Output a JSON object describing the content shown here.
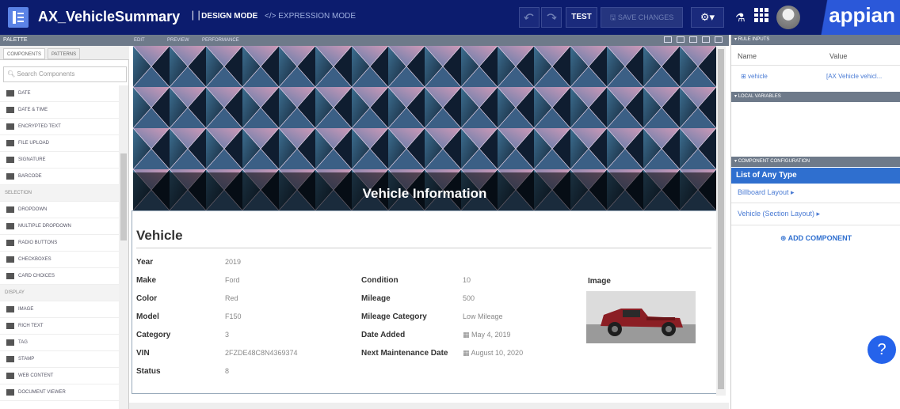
{
  "header": {
    "app_title": "AX_VehicleSummary",
    "design_mode": "DESIGN MODE",
    "expression_mode": "EXPRESSION MODE",
    "test": "TEST",
    "save": "SAVE CHANGES",
    "brand": "appian"
  },
  "palette": {
    "title": "PALETTE",
    "tabs": [
      "COMPONENTS",
      "PATTERNS"
    ],
    "search_placeholder": "Search Components",
    "items": [
      {
        "label": "DATE",
        "section": false
      },
      {
        "label": "DATE & TIME",
        "section": false
      },
      {
        "label": "ENCRYPTED TEXT",
        "section": false
      },
      {
        "label": "FILE UPLOAD",
        "section": false
      },
      {
        "label": "SIGNATURE",
        "section": false
      },
      {
        "label": "BARCODE",
        "section": false
      },
      {
        "label": "SELECTION",
        "section": true
      },
      {
        "label": "DROPDOWN",
        "section": false
      },
      {
        "label": "MULTIPLE DROPDOWN",
        "section": false
      },
      {
        "label": "RADIO BUTTONS",
        "section": false
      },
      {
        "label": "CHECKBOXES",
        "section": false
      },
      {
        "label": "CARD CHOICES",
        "section": false
      },
      {
        "label": "DISPLAY",
        "section": true
      },
      {
        "label": "IMAGE",
        "section": false
      },
      {
        "label": "RICH TEXT",
        "section": false
      },
      {
        "label": "TAG",
        "section": false
      },
      {
        "label": "STAMP",
        "section": false
      },
      {
        "label": "WEB CONTENT",
        "section": false
      },
      {
        "label": "DOCUMENT VIEWER",
        "section": false
      }
    ]
  },
  "canvas": {
    "tabs": [
      "EDIT",
      "PREVIEW",
      "PERFORMANCE"
    ],
    "banner_title": "Vehicle Information",
    "section_title": "Vehicle",
    "col1": [
      {
        "label": "Year",
        "value": "2019"
      },
      {
        "label": "Make",
        "value": "Ford"
      },
      {
        "label": "Color",
        "value": "Red"
      },
      {
        "label": "Model",
        "value": "F150"
      },
      {
        "label": "Category",
        "value": "3"
      },
      {
        "label": "VIN",
        "value": "2FZDE48C8N4369374"
      },
      {
        "label": "Status",
        "value": "8"
      }
    ],
    "col2": [
      {
        "label": "Condition",
        "value": "10"
      },
      {
        "label": "Mileage",
        "value": "500"
      },
      {
        "label": "Mileage Category",
        "value": "Low Mileage"
      },
      {
        "label": "Date Added",
        "value": "May 4, 2019"
      },
      {
        "label": "Next Maintenance Date",
        "value": "August 10, 2020"
      }
    ],
    "image_label": "Image"
  },
  "rules": {
    "rule_inputs": "RULE INPUTS",
    "name_header": "Name",
    "value_header": "Value",
    "param_name": "vehicle",
    "param_value": "[AX Vehicle vehicl...",
    "local_vars": "LOCAL VARIABLES",
    "comp_config": "COMPONENT CONFIGURATION",
    "list_any": "List of Any Type",
    "cfg1": "Billboard Layout ▸",
    "cfg2": "Vehicle (Section Layout) ▸",
    "add": "ADD COMPONENT"
  },
  "colors": {
    "top_bar": "#0c1c6e",
    "accent": "#2f6fcf",
    "brand": "#2b58d9"
  }
}
